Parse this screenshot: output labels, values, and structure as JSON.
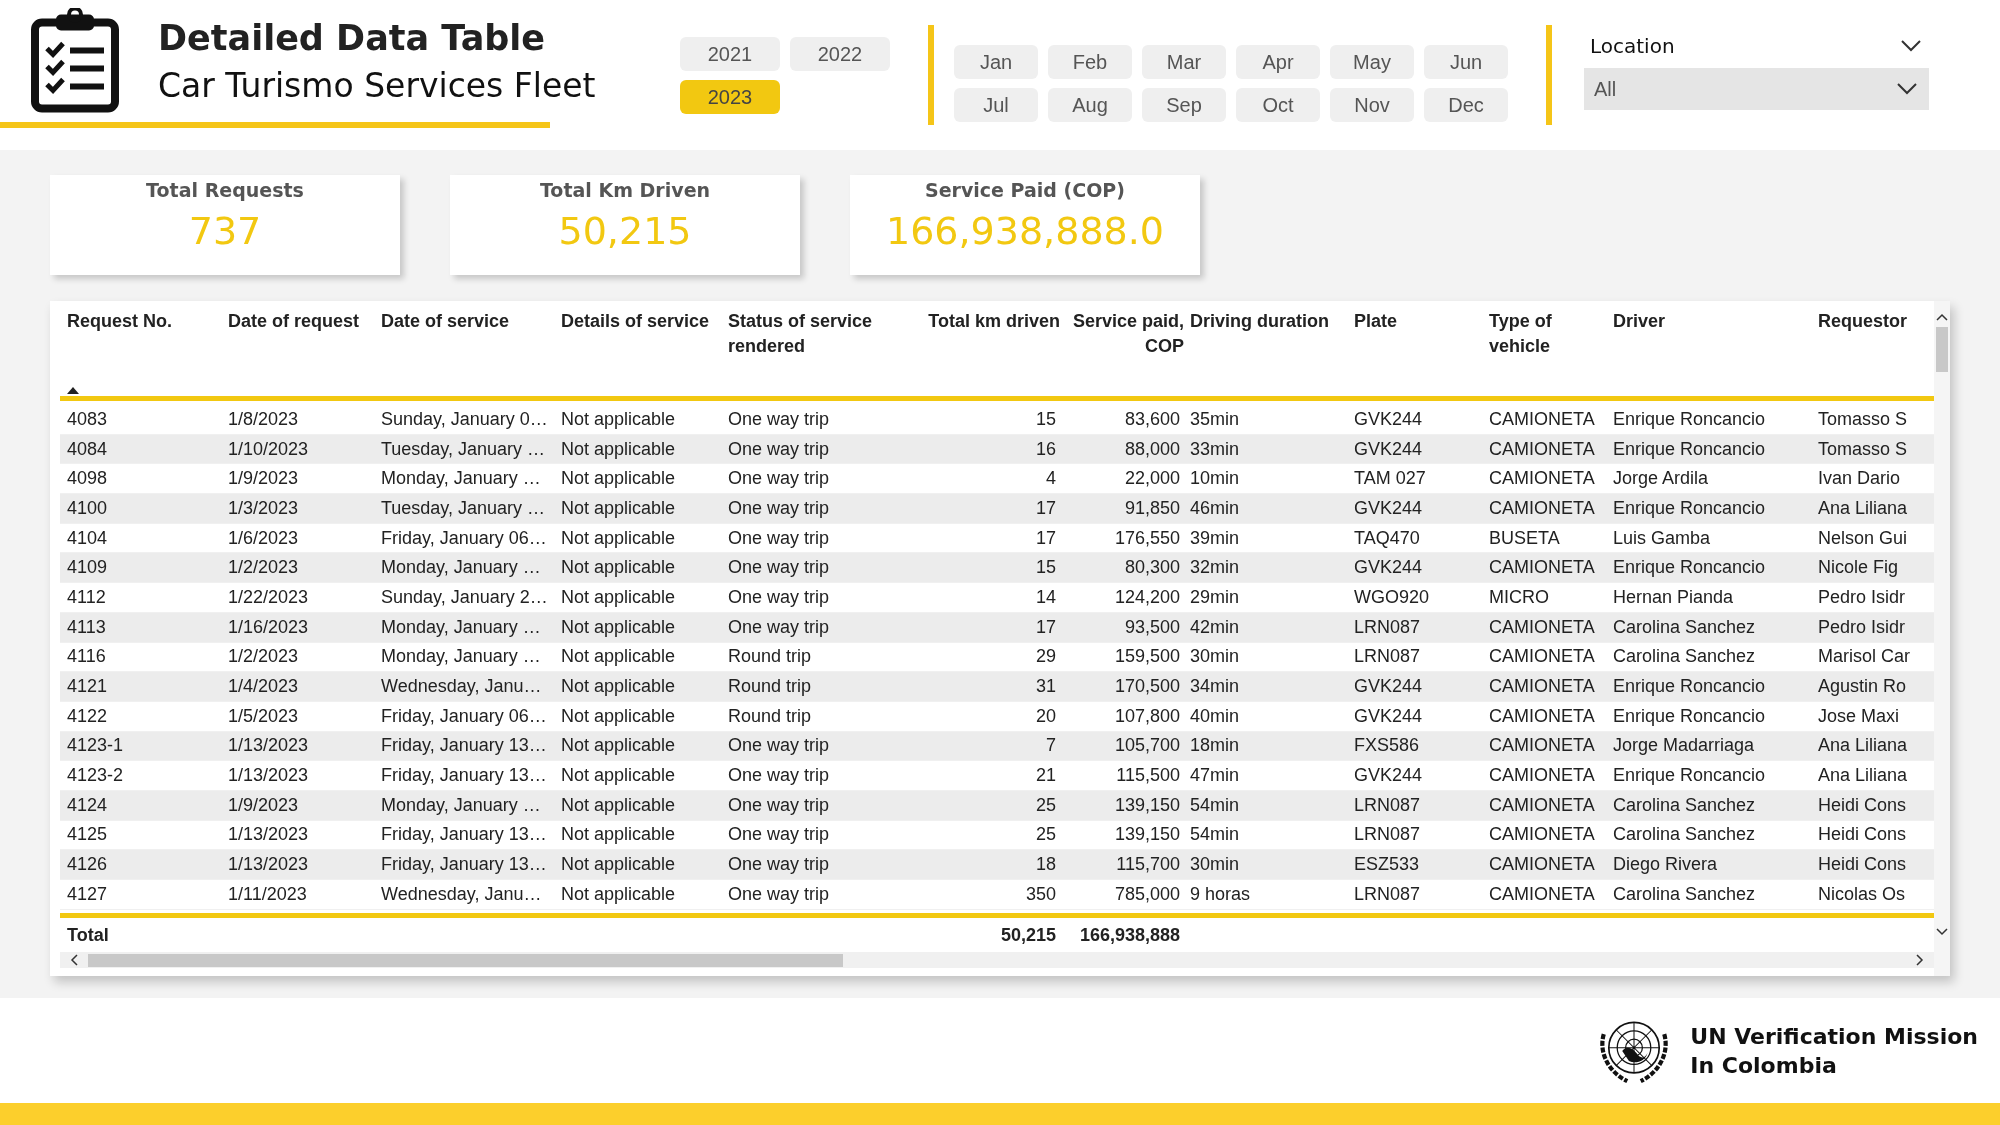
{
  "header": {
    "title": "Detailed Data Table",
    "subtitle": "Car Turismo Services Fleet"
  },
  "years": [
    {
      "label": "2021",
      "selected": false
    },
    {
      "label": "2022",
      "selected": false
    },
    {
      "label": "2023",
      "selected": true
    }
  ],
  "months": [
    {
      "label": "Jan",
      "selected": false
    },
    {
      "label": "Feb",
      "selected": false
    },
    {
      "label": "Mar",
      "selected": false
    },
    {
      "label": "Apr",
      "selected": false
    },
    {
      "label": "May",
      "selected": false
    },
    {
      "label": "Jun",
      "selected": false
    },
    {
      "label": "Jul",
      "selected": false
    },
    {
      "label": "Aug",
      "selected": false
    },
    {
      "label": "Sep",
      "selected": false
    },
    {
      "label": "Oct",
      "selected": false
    },
    {
      "label": "Nov",
      "selected": false
    },
    {
      "label": "Dec",
      "selected": false
    }
  ],
  "location": {
    "label": "Location",
    "value": "All"
  },
  "kpis": [
    {
      "label": "Total Requests",
      "value": "737"
    },
    {
      "label": "Total Km Driven",
      "value": "50,215"
    },
    {
      "label": "Service Paid (COP)",
      "value": "166,938,888.0"
    }
  ],
  "table": {
    "columns": [
      {
        "label": "Request No.",
        "kind": "text",
        "sorted": true
      },
      {
        "label": "Date of request",
        "kind": "text",
        "sorted": false
      },
      {
        "label": "Date of service",
        "kind": "text",
        "sorted": false
      },
      {
        "label": "Details of service",
        "kind": "text",
        "sorted": false
      },
      {
        "label": "Status of service rendered",
        "kind": "text",
        "sorted": false
      },
      {
        "label": "Total km driven",
        "kind": "number",
        "sorted": false
      },
      {
        "label": "Service paid, COP",
        "kind": "number",
        "sorted": false
      },
      {
        "label": "Driving duration",
        "kind": "text",
        "sorted": false
      },
      {
        "label": "Plate",
        "kind": "text",
        "sorted": false
      },
      {
        "label": "Type of vehicle",
        "kind": "text",
        "sorted": false
      },
      {
        "label": "Driver",
        "kind": "text",
        "sorted": false
      },
      {
        "label": "Requestor",
        "kind": "text",
        "sorted": false
      }
    ],
    "rows": [
      [
        "4083",
        "1/8/2023",
        "Sunday, January 0…",
        "Not applicable",
        "One way trip",
        "15",
        "83,600",
        "35min",
        "GVK244",
        "CAMIONETA",
        "Enrique Roncancio",
        "Tomasso S"
      ],
      [
        "4084",
        "1/10/2023",
        "Tuesday, January …",
        "Not applicable",
        "One way trip",
        "16",
        "88,000",
        "33min",
        "GVK244",
        "CAMIONETA",
        "Enrique Roncancio",
        "Tomasso S"
      ],
      [
        "4098",
        "1/9/2023",
        "Monday, January …",
        "Not applicable",
        "One way trip",
        "4",
        "22,000",
        "10min",
        "TAM 027",
        "CAMIONETA",
        "Jorge Ardila",
        "Ivan Dario"
      ],
      [
        "4100",
        "1/3/2023",
        "Tuesday, January …",
        "Not applicable",
        "One way trip",
        "17",
        "91,850",
        "46min",
        "GVK244",
        "CAMIONETA",
        "Enrique Roncancio",
        "Ana Liliana"
      ],
      [
        "4104",
        "1/6/2023",
        "Friday, January 06…",
        "Not applicable",
        "One way trip",
        "17",
        "176,550",
        "39min",
        "TAQ470",
        "BUSETA",
        "Luis Gamba",
        "Nelson Gui"
      ],
      [
        "4109",
        "1/2/2023",
        "Monday, January …",
        "Not applicable",
        "One way trip",
        "15",
        "80,300",
        "32min",
        "GVK244",
        "CAMIONETA",
        "Enrique Roncancio",
        "Nicole Fig"
      ],
      [
        "4112",
        "1/22/2023",
        "Sunday, January 2…",
        "Not applicable",
        "One way trip",
        "14",
        "124,200",
        "29min",
        "WGO920",
        "MICRO",
        "Hernan Pianda",
        "Pedro Isidr"
      ],
      [
        "4113",
        "1/16/2023",
        "Monday, January …",
        "Not applicable",
        "One way trip",
        "17",
        "93,500",
        "42min",
        "LRN087",
        "CAMIONETA",
        "Carolina Sanchez",
        "Pedro Isidr"
      ],
      [
        "4116",
        "1/2/2023",
        "Monday, January …",
        "Not applicable",
        "Round trip",
        "29",
        "159,500",
        "30min",
        "LRN087",
        "CAMIONETA",
        "Carolina Sanchez",
        "Marisol Car"
      ],
      [
        "4121",
        "1/4/2023",
        "Wednesday, Janu…",
        "Not applicable",
        "Round trip",
        "31",
        "170,500",
        "34min",
        "GVK244",
        "CAMIONETA",
        "Enrique Roncancio",
        "Agustin Ro"
      ],
      [
        "4122",
        "1/5/2023",
        "Friday, January 06…",
        "Not applicable",
        "Round trip",
        "20",
        "107,800",
        "40min",
        "GVK244",
        "CAMIONETA",
        "Enrique Roncancio",
        "Jose Maxi"
      ],
      [
        "4123-1",
        "1/13/2023",
        "Friday, January 13…",
        "Not applicable",
        "One way trip",
        "7",
        "105,700",
        "18min",
        "FXS586",
        "CAMIONETA",
        "Jorge Madarriaga",
        "Ana Liliana"
      ],
      [
        "4123-2",
        "1/13/2023",
        "Friday, January 13…",
        "Not applicable",
        "One way trip",
        "21",
        "115,500",
        "47min",
        "GVK244",
        "CAMIONETA",
        "Enrique Roncancio",
        "Ana Liliana"
      ],
      [
        "4124",
        "1/9/2023",
        "Monday, January …",
        "Not applicable",
        "One way trip",
        "25",
        "139,150",
        "54min",
        "LRN087",
        "CAMIONETA",
        "Carolina Sanchez",
        "Heidi Cons"
      ],
      [
        "4125",
        "1/13/2023",
        "Friday, January 13…",
        "Not applicable",
        "One way trip",
        "25",
        "139,150",
        "54min",
        "LRN087",
        "CAMIONETA",
        "Carolina Sanchez",
        "Heidi Cons"
      ],
      [
        "4126",
        "1/13/2023",
        "Friday, January 13…",
        "Not applicable",
        "One way trip",
        "18",
        "115,700",
        "30min",
        "ESZ533",
        "CAMIONETA",
        "Diego Rivera",
        "Heidi Cons"
      ],
      [
        "4127",
        "1/11/2023",
        "Wednesday, Janu…",
        "Not applicable",
        "One way trip",
        "350",
        "785,000",
        "9 horas",
        "LRN087",
        "CAMIONETA",
        "Carolina Sanchez",
        "Nicolas Os"
      ]
    ],
    "total": {
      "label": "Total",
      "km": "50,215",
      "paid": "166,938,888"
    }
  },
  "footer": {
    "org_line_1": "UN Verification Mission",
    "org_line_2": "In Colombia"
  }
}
